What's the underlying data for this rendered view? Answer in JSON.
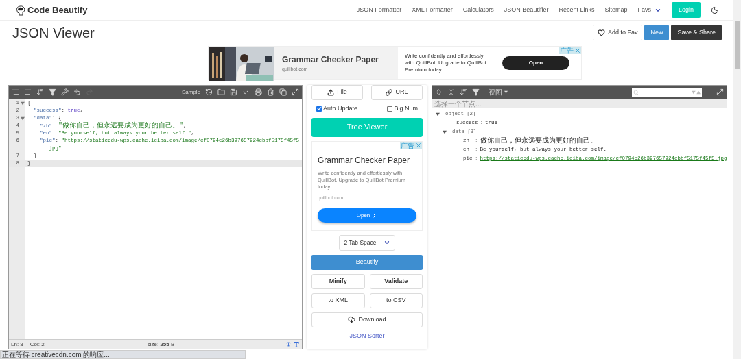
{
  "brand": "Code Beautify",
  "nav": {
    "links": [
      "JSON Formatter",
      "XML Formatter",
      "Calculators",
      "JSON Beautifier",
      "Recent Links",
      "Sitemap"
    ],
    "favs": "Favs",
    "login": "Login"
  },
  "title": "JSON Viewer",
  "actions": {
    "fav": "Add to Fav",
    "new": "New",
    "save": "Save & Share"
  },
  "top_ad": {
    "title": "Grammar Checker Paper",
    "domain": "quillbot.com",
    "text": "Write confidently and effortlessly with QuillBot. Upgrade to QuillBot Premium today.",
    "open": "Open",
    "ad_label": "广告"
  },
  "editor": {
    "sample": "Sample",
    "lines": [
      {
        "number": "1",
        "foldable": true,
        "active": false,
        "tokens": [
          {
            "kind": "punct",
            "text": "{"
          }
        ]
      },
      {
        "number": "2",
        "foldable": false,
        "active": false,
        "tokens": [
          {
            "kind": "key",
            "text": "  \"success\""
          },
          {
            "kind": "punct",
            "text": ": "
          },
          {
            "kind": "bool",
            "text": "true"
          },
          {
            "kind": "punct",
            "text": ","
          }
        ]
      },
      {
        "number": "3",
        "foldable": true,
        "active": false,
        "tokens": [
          {
            "kind": "key",
            "text": "  \"data\""
          },
          {
            "kind": "punct",
            "text": ": {"
          }
        ]
      },
      {
        "number": "4",
        "foldable": false,
        "active": false,
        "tokens": [
          {
            "kind": "key",
            "text": "    \"zh\""
          },
          {
            "kind": "punct",
            "text": ": "
          },
          {
            "kind": "string",
            "text": "\"做你自己，但永远要成为更好的自己。\""
          },
          {
            "kind": "punct",
            "text": ","
          }
        ]
      },
      {
        "number": "5",
        "foldable": false,
        "active": false,
        "tokens": [
          {
            "kind": "key",
            "text": "    \"en\""
          },
          {
            "kind": "punct",
            "text": ": "
          },
          {
            "kind": "string",
            "text": "\"Be yourself, but always your better self.\""
          },
          {
            "kind": "punct",
            "text": ","
          }
        ]
      },
      {
        "number": "6",
        "foldable": false,
        "active": false,
        "tokens": [
          {
            "kind": "key",
            "text": "    \"pic\""
          },
          {
            "kind": "punct",
            "text": ": "
          },
          {
            "kind": "string",
            "text": "\"https://staticedu-wps.cache.iciba.com/image/cf0794e26b397657924cbbf5175f45f5"
          }
        ],
        "continuation": [
          {
            "kind": "string",
            "text": "      .jpg\""
          }
        ]
      },
      {
        "number": "7",
        "foldable": false,
        "active": false,
        "tokens": [
          {
            "kind": "punct",
            "text": "  }"
          }
        ]
      },
      {
        "number": "8",
        "foldable": false,
        "active": true,
        "tokens": [
          {
            "kind": "punct",
            "text": "}"
          }
        ]
      }
    ],
    "footer": {
      "line": "Ln: 8",
      "col": "Col: 2",
      "size": "size: **255** B"
    }
  },
  "middle": {
    "file": "File",
    "url": "URL",
    "checks": [
      {
        "label": "Auto Update",
        "checked": true
      },
      {
        "label": "Big Num",
        "checked": false
      }
    ],
    "tree_viewer": "Tree Viewer",
    "ad": {
      "title": "Grammar Checker Paper",
      "text": "Write confidently and effortlessly with QuillBot. Upgrade to QuillBot Premium today.",
      "domain": "quillbot.com",
      "open": "Open",
      "ad_label": "广告"
    },
    "indent": "2 Tab Space",
    "beautify": "Beautify",
    "minify": "Minify",
    "validate": "Validate",
    "to_xml": "to XML",
    "to_csv": "to CSV",
    "download": "Download",
    "sorter": "JSON Sorter"
  },
  "viewer": {
    "menu": "视图",
    "status": "选择一个节点...",
    "separator": ":",
    "tree": [
      {
        "key": "object",
        "count": "{2}",
        "expanded": true,
        "children": [
          {
            "key": "success",
            "value": "true",
            "kind": "value"
          },
          {
            "key": "data",
            "count": "{3}",
            "expanded": true,
            "kind": "node",
            "children": [
              {
                "key": "zh",
                "value": "做你自己，但永远要成为更好的自己。",
                "kind": "value"
              },
              {
                "key": "en",
                "value": "Be yourself, but always your better self.",
                "kind": "value"
              },
              {
                "key": "pic",
                "value": "https://staticedu-wps.cache.iciba.com/image/cf0794e26b397657924cbbf5175f45f5.jpg",
                "kind": "link"
              }
            ]
          }
        ]
      }
    ]
  },
  "browser_status": "正在等待 creativecdn.com 的响应..."
}
